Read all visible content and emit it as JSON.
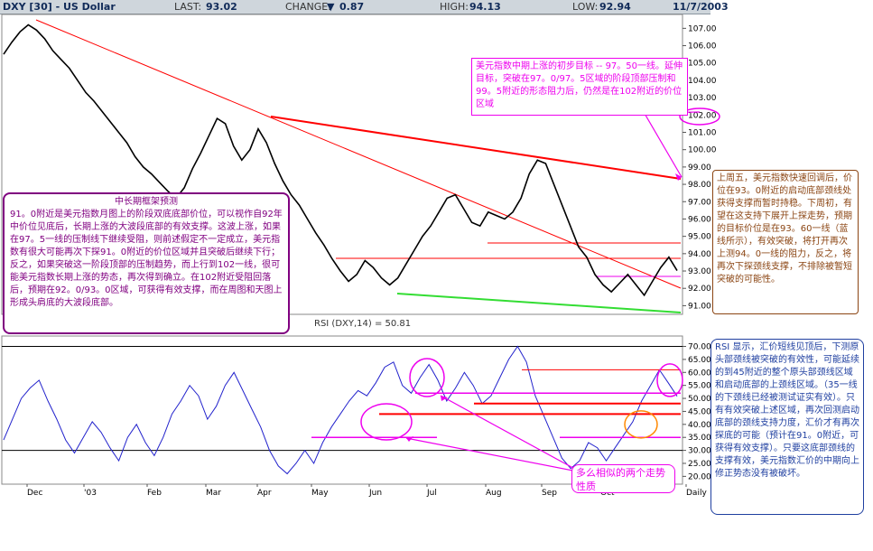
{
  "header": {
    "symbol": "DXY [30] - US Dollar",
    "last_label": "LAST:",
    "last": "93.02",
    "change_label": "CHANGE:",
    "change": "0.87",
    "high_label": "HIGH:",
    "high": "94.13",
    "low_label": "LOW:",
    "low": "92.94",
    "date": "11/7/2003"
  },
  "colors": {
    "price": "#000000",
    "trend_red": "#ff0000",
    "support_green": "#33dd33",
    "rsi_line": "#2222cc",
    "magenta": "#ee00ee",
    "orange": "#ff8800",
    "note_purple": "#800080",
    "note_brown": "#8b4513",
    "note_blue": "#1f3fa0"
  },
  "chart_data": [
    {
      "type": "line",
      "name_label": "DXY",
      "x_ticks": [
        "Dec",
        "'03",
        "Feb",
        "Mar",
        "Apr",
        "May",
        "Jun",
        "Jul",
        "Aug",
        "Sep",
        "Oct",
        "Daily"
      ],
      "y_ticks": [
        "91.00",
        "92.00",
        "93.00",
        "94.00",
        "95.00",
        "96.00",
        "97.00",
        "98.00",
        "99.00",
        "100.00",
        "101.00",
        "102.00",
        "103.00",
        "104.00",
        "105.00",
        "106.00",
        "107.00"
      ],
      "ylim": [
        90.5,
        107.8
      ],
      "series": [
        {
          "values": [
            105.5,
            106.2,
            106.8,
            107.2,
            106.9,
            106.4,
            105.7,
            105.2,
            104.7,
            104.0,
            103.3,
            102.8,
            102.2,
            101.6,
            101.0,
            100.4,
            99.6,
            99.0,
            98.6,
            98.1,
            97.6,
            97.2,
            97.8,
            98.9,
            99.8,
            100.8,
            101.8,
            101.5,
            100.2,
            99.4,
            100.0,
            101.2,
            100.4,
            99.2,
            98.2,
            97.4,
            96.8,
            96.0,
            95.2,
            94.5,
            93.7,
            93.0,
            92.4,
            92.8,
            93.6,
            93.2,
            92.6,
            92.2,
            92.6,
            93.4,
            94.2,
            95.0,
            95.6,
            96.4,
            97.2,
            97.4,
            96.6,
            95.8,
            95.6,
            96.4,
            96.2,
            96.0,
            96.4,
            97.2,
            98.6,
            99.4,
            99.2,
            98.0,
            96.8,
            95.6,
            94.4,
            93.8,
            92.8,
            92.2,
            91.8,
            92.3,
            92.8,
            92.2,
            91.6,
            92.4,
            93.2,
            93.8,
            93.02
          ]
        }
      ]
    },
    {
      "type": "line",
      "name_label": "RSI (DXY,14) = 50.81",
      "y_ticks": [
        "20.00",
        "25.00",
        "30.00",
        "35.00",
        "40.00",
        "45.00",
        "50.00",
        "55.00",
        "60.00",
        "65.00",
        "70.00"
      ],
      "ylim": [
        17,
        74
      ],
      "series": [
        {
          "values": [
            34,
            42,
            50,
            54,
            57,
            49,
            42,
            34,
            29,
            35,
            41,
            37,
            31,
            26,
            35,
            40,
            33,
            28,
            35,
            44,
            49,
            55,
            51,
            42,
            47,
            55,
            60,
            53,
            46,
            39,
            30,
            24,
            21,
            25,
            30,
            25,
            33,
            39,
            44,
            49,
            53,
            51,
            56,
            62,
            64,
            55,
            52,
            58,
            63,
            57,
            49,
            54,
            60,
            55,
            48,
            51,
            58,
            65,
            70,
            64,
            51,
            43,
            35,
            27,
            23,
            26,
            33,
            31,
            26,
            31,
            36,
            41,
            49,
            55,
            61,
            56,
            50.81
          ]
        }
      ]
    }
  ],
  "notes": {
    "note1": {
      "text": "美元指数中期上涨的初步目标 -- 97。50一线。延伸目标，突破在97。0/97。5区域的阶段顶部压制和 99。5附近的形态阻力后，仍然是在102附近的价位区域"
    },
    "note2": {
      "title": "中长期框架预测",
      "text": "91。0附近是美元指数月图上的阶段双底底部价位，可以视作自92年中价位见底后，长期上涨的大波段底部的有效支撑。这波上涨，如果在97。5一线的压制线下继续受阻，则前述假定不一定成立，美元指数有很大可能再次下探91。0附近的价位区域并且突破后继续下行；反之，如果突破这一阶段顶部的压制趋势，而上行到102一线，很可能美元指数长期上涨的势态，再次得到确立。在102附近受阻回落后，预期在92。0/93。0区域，可获得有效支撑，而在周图和天图上形成头肩底的大波段底部。"
    },
    "note3": {
      "text": "上周五，美元指数快速回调后，价位在93。0附近的启动底部颈线处获得支撑而暂时持稳。下周初，有望在这支持下展开上探走势，预期的目标价位是在93。60一线（蓝线所示），有效突破，将打开再次上测94。0一线的阻力，反之，将再次下探颈线支撑，不排除被暂短突破的可能性。"
    },
    "note4": {
      "text": "RSI 显示，汇价短线见顶后，下测原头部颈线被突破的有效性，可能延续的到45附近的整个原头部颈线区域和启动底部的上颈线区域。（35一线的下颈线已经被测试证实有效）。只有有效突破上述区域，再次回测启动底部的颈线支持力度，汇价才有再次探底的可能（预计在91。0附近，可获得有效支撑）。只要这底部颈线的支撑有效，美元指数汇价的中期向上修正势态没有被破坏。"
    },
    "note5": {
      "text": "多么相似的两个走势性质"
    }
  }
}
